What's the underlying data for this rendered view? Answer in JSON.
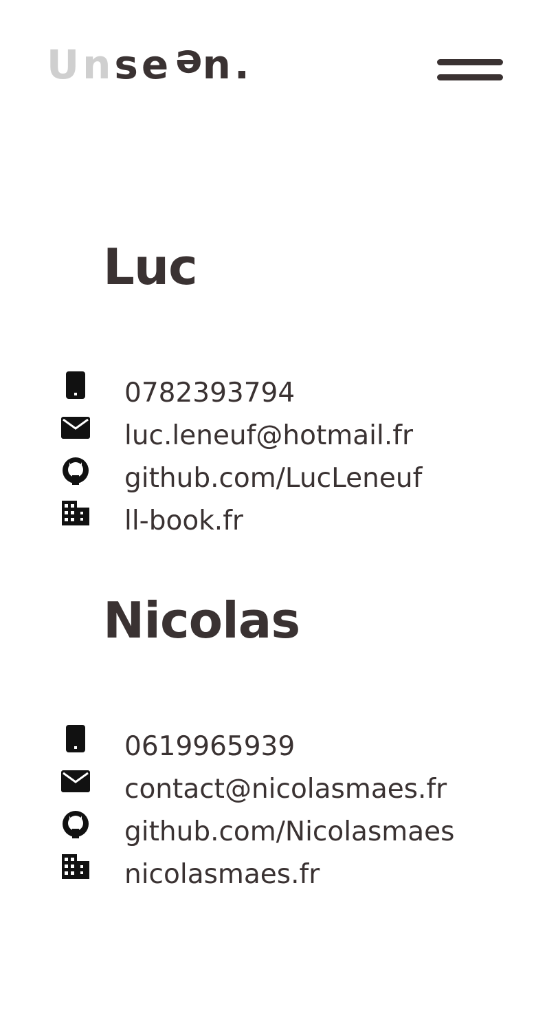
{
  "header": {
    "logo": {
      "part1": "Un",
      "part2": "se",
      "part3": "e",
      "part4": "n."
    },
    "menu_icon": "hamburger-menu-icon"
  },
  "contacts": [
    {
      "name": "Luc",
      "phone": "0782393794",
      "email": "luc.leneuf@hotmail.fr",
      "github": "github.com/LucLeneuf",
      "website": "ll-book.fr"
    },
    {
      "name": "Nicolas",
      "phone": "0619965939",
      "email": "contact@nicolasmaes.fr",
      "github": "github.com/Nicolasmaes",
      "website": "nicolasmaes.fr"
    }
  ],
  "icons": {
    "phone": "smartphone-icon",
    "email": "envelope-icon",
    "github": "github-icon",
    "website": "building-icon"
  },
  "colors": {
    "text": "#3a3232",
    "logo_light": "#cfcfcf",
    "background": "#ffffff"
  }
}
